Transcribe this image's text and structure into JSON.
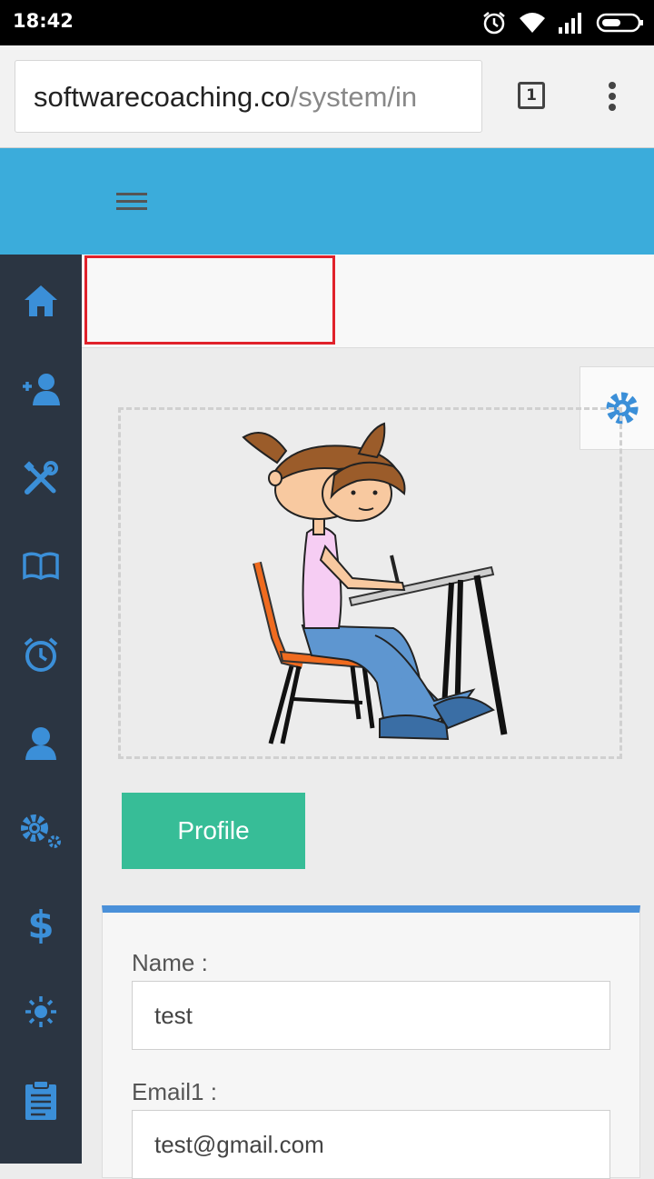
{
  "status_bar": {
    "time": "18:42"
  },
  "browser": {
    "url_host": "softwarecoaching.co",
    "url_path": "/system/in",
    "tab_count": "1"
  },
  "sidebar": {
    "items": [
      {
        "icon": "home-icon",
        "label": "Home"
      },
      {
        "icon": "add-user-icon",
        "label": "Add user"
      },
      {
        "icon": "tools-icon",
        "label": "Tools"
      },
      {
        "icon": "book-icon",
        "label": "Book"
      },
      {
        "icon": "alarm-clock-icon",
        "label": "Alarm"
      },
      {
        "icon": "user-icon",
        "label": "User"
      },
      {
        "icon": "gears-icon",
        "label": "Settings"
      },
      {
        "icon": "dollar-icon",
        "label": "Billing"
      },
      {
        "icon": "sun-icon",
        "label": "Brightness"
      },
      {
        "icon": "clipboard-icon",
        "label": "Clipboard"
      }
    ],
    "color": "#2b3542",
    "icon_color": "#3b8fd8"
  },
  "profile": {
    "button_label": "Profile"
  },
  "form": {
    "name_label": "Name :",
    "name_value": "test",
    "email_label": "Email1 :",
    "email_value": "test@gmail.com"
  },
  "colors": {
    "header": "#3bacdb",
    "accent": "#37bd97",
    "card_top": "#4a90d9",
    "highlight": "#e0222b"
  }
}
